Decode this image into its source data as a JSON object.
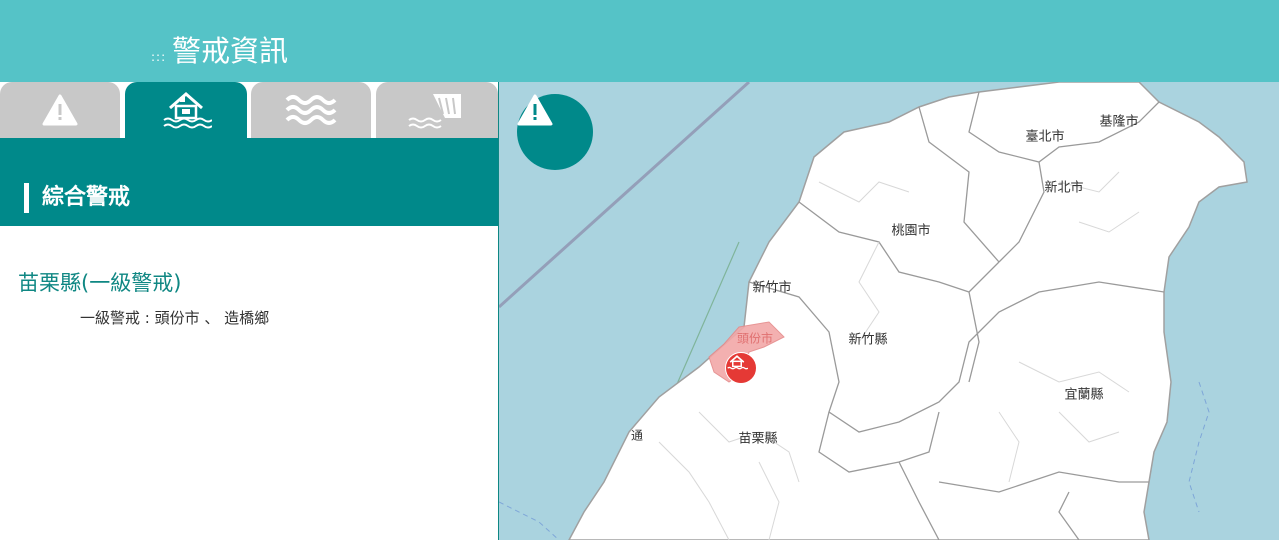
{
  "header": {
    "menu_glyph": ":::",
    "title": "警戒資訊"
  },
  "tabs": [
    {
      "icon": "warning-icon",
      "active": false
    },
    {
      "icon": "flood-house-icon",
      "active": true
    },
    {
      "icon": "waves-icon",
      "active": false
    },
    {
      "icon": "dam-icon",
      "active": false
    }
  ],
  "section": {
    "title": "綜合警戒"
  },
  "alerts": {
    "county": "苗栗縣(一級警戒)",
    "detail": "一級警戒 : 頭份市 、 造橋鄉"
  },
  "map": {
    "labels": {
      "taipei": "臺北市",
      "keelung": "基隆市",
      "new_taipei": "新北市",
      "taoyuan": "桃園市",
      "hsinchu_city": "新竹市",
      "hsinchu_county": "新竹縣",
      "miaoli": "苗栗縣",
      "yilan": "宜蘭縣",
      "toufen": "頭份市",
      "tong": "通"
    },
    "colors": {
      "sea": "#aad3df",
      "land": "#ffffff",
      "alert_area": "#f2a8a8",
      "marker": "#e53935",
      "accent": "#00898a"
    }
  }
}
